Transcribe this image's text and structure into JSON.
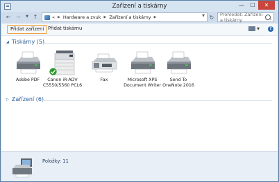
{
  "window": {
    "title": "Zařízení a tiskárny",
    "minimize_icon": "minimize-icon",
    "maximize_icon": "maximize-icon",
    "close_icon": "close-icon"
  },
  "address": {
    "overflow": "«",
    "crumb1": "Hardware a zvuk",
    "crumb2": "Zařízení a tiskárny"
  },
  "search": {
    "placeholder": "Prohledat: Zařízení a tiskárny"
  },
  "toolbar": {
    "add_device": "Přidat zařízení",
    "add_printer": "Přidat tiskárnu",
    "help": "?"
  },
  "groups": [
    {
      "label": "Tiskárny (5)",
      "expanded": true
    },
    {
      "label": "Zařízení (6)",
      "expanded": false
    }
  ],
  "printers": [
    {
      "name": "Adobe PDF",
      "line2": ""
    },
    {
      "name": "Canon iR-ADV",
      "line2": "C5550/5560 PCL6",
      "default": true
    },
    {
      "name": "Fax",
      "line2": ""
    },
    {
      "name": "Microsoft XPS",
      "line2": "Document Writer"
    },
    {
      "name": "Send To",
      "line2": "OneNote 2016"
    }
  ],
  "status": {
    "text": "Položky: 11"
  },
  "colors": {
    "accent": "#2e5e9b",
    "default_check": "#2d9a2f",
    "focus_border": "#f0a040"
  }
}
